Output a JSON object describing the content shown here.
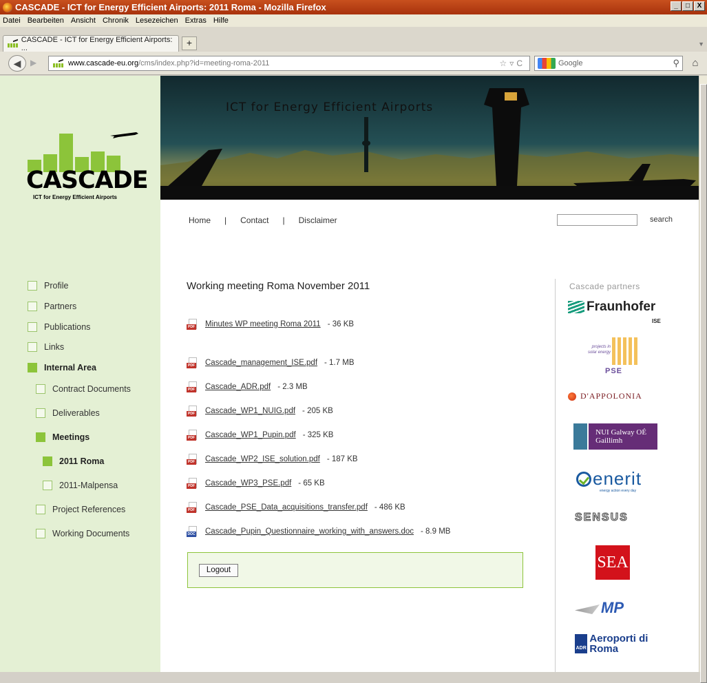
{
  "window": {
    "title": "CASCADE - ICT for Energy Efficient Airports: 2011 Roma - Mozilla Firefox",
    "controls": [
      "_",
      "□",
      "X"
    ]
  },
  "menu": [
    "Datei",
    "Bearbeiten",
    "Ansicht",
    "Chronik",
    "Lesezeichen",
    "Extras",
    "Hilfe"
  ],
  "tab": {
    "label": "CASCADE - ICT for Energy Efficient Airports: ...",
    "new_tab": "+"
  },
  "url": {
    "host": "www.cascade-eu.org",
    "path": "/cms/index.php?id=meeting-roma-2011"
  },
  "browser_search": {
    "placeholder": "Google"
  },
  "logo": {
    "word": "CASCADE",
    "tagline": "ICT for Energy Efficient Airports"
  },
  "banner": {
    "title": "ICT for Energy Efficient Airports"
  },
  "top_nav": {
    "home": "Home",
    "sep": "|",
    "contact": "Contact",
    "disclaimer": "Disclaimer",
    "search_button": "search"
  },
  "sidebar": {
    "items": [
      {
        "label": "Profile"
      },
      {
        "label": "Partners"
      },
      {
        "label": "Publications"
      },
      {
        "label": "Links"
      },
      {
        "label": "Internal Area"
      },
      {
        "label": "Contract Documents"
      },
      {
        "label": "Deliverables"
      },
      {
        "label": "Meetings"
      },
      {
        "label": "2011 Roma"
      },
      {
        "label": "2011-Malpensa"
      },
      {
        "label": "Project References"
      },
      {
        "label": "Working Documents"
      }
    ]
  },
  "main": {
    "title": "Working meeting Roma November 2011",
    "files": [
      {
        "name": "Minutes WP meeting Roma 2011",
        "size": "-   36 KB",
        "type": "PDF"
      },
      {
        "name": "Cascade_management_ISE.pdf",
        "size": "-   1.7 MB",
        "type": "PDF"
      },
      {
        "name": "Cascade_ADR.pdf",
        "size": "-   2.3 MB",
        "type": "PDF"
      },
      {
        "name": "Cascade_WP1_NUIG.pdf",
        "size": "-   205 KB",
        "type": "PDF"
      },
      {
        "name": "Cascade_WP1_Pupin.pdf",
        "size": "-   325 KB",
        "type": "PDF"
      },
      {
        "name": "Cascade_WP2_ISE_solution.pdf",
        "size": "-   187 KB",
        "type": "PDF"
      },
      {
        "name": "Cascade_WP3_PSE.pdf",
        "size": "-   65 KB",
        "type": "PDF"
      },
      {
        "name": "Cascade_PSE_Data_acquisitions_transfer.pdf",
        "size": "-   486 KB",
        "type": "PDF"
      },
      {
        "name": "Cascade_Pupin_Questionnaire_working_with_answers.doc",
        "size": "-   8.9 MB",
        "type": "DOC"
      }
    ],
    "logout": "Logout"
  },
  "partners": {
    "title": "Cascade partners",
    "fraunhofer": "Fraunhofer",
    "fraunhofer_sub": "ISE",
    "pse_text": "projects in solar energy",
    "pse_name": "PSE",
    "dappolonia": "D'APPOLONIA",
    "nui": "NUI Galway OÉ Gaillimh",
    "enerit": "enerit",
    "enerit_sub": "energy action every day",
    "sensus": "SENSUS",
    "sea": "SEA",
    "amp": "MP",
    "adr_box": "ADR",
    "adr": "Aeroporti di Roma"
  }
}
